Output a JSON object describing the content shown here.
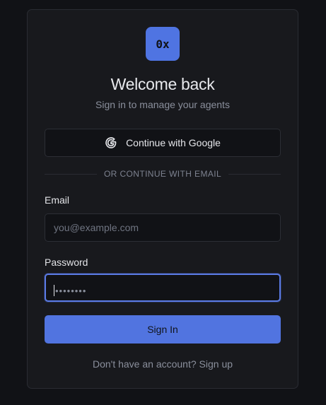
{
  "logo": {
    "text": "0x",
    "color": "#4f74e2"
  },
  "header": {
    "title": "Welcome back",
    "subtitle": "Sign in to manage your agents"
  },
  "oauth": {
    "google_label": "Continue with Google",
    "icon": "google-icon"
  },
  "divider": {
    "label": "OR CONTINUE WITH EMAIL"
  },
  "form": {
    "email": {
      "label": "Email",
      "placeholder": "you@example.com",
      "value": ""
    },
    "password": {
      "label": "Password",
      "value_masked": "••••••••",
      "focused": true
    },
    "submit_label": "Sign In"
  },
  "footer": {
    "text": "Don't have an account?",
    "link_label": "Sign up"
  },
  "colors": {
    "accent": "#5174e0",
    "background": "#111216",
    "card": "#18191d"
  }
}
